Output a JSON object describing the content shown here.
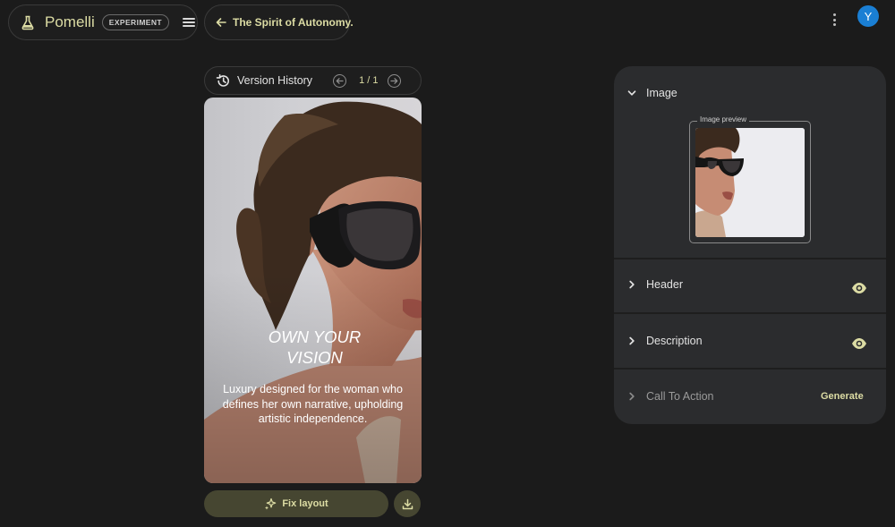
{
  "brand": {
    "name": "Pomelli",
    "badge": "EXPERIMENT"
  },
  "nav": {
    "back_label": "The Spirit of Autonomy."
  },
  "user": {
    "avatar_letter": "Y",
    "avatar_color": "#1a7fd4"
  },
  "version_history": {
    "label": "Version History",
    "counter": "1 / 1"
  },
  "creative": {
    "headline": "OWN YOUR\nVISION",
    "description": "Luxury designed for the woman who defines her own narrative, upholding artistic independence."
  },
  "actions": {
    "fix_layout": "Fix layout"
  },
  "panel": {
    "sections": [
      {
        "title": "Image",
        "expanded": true,
        "preview_label": "Image preview"
      },
      {
        "title": "Header",
        "expanded": false,
        "visible": true
      },
      {
        "title": "Description",
        "expanded": false,
        "visible": true
      },
      {
        "title": "Call To Action",
        "expanded": false,
        "action": "Generate"
      }
    ]
  },
  "colors": {
    "accent": "#dcdca4",
    "button_bg": "#464631",
    "panel_bg": "#2b2c2e",
    "page_bg": "#1b1b1b"
  }
}
